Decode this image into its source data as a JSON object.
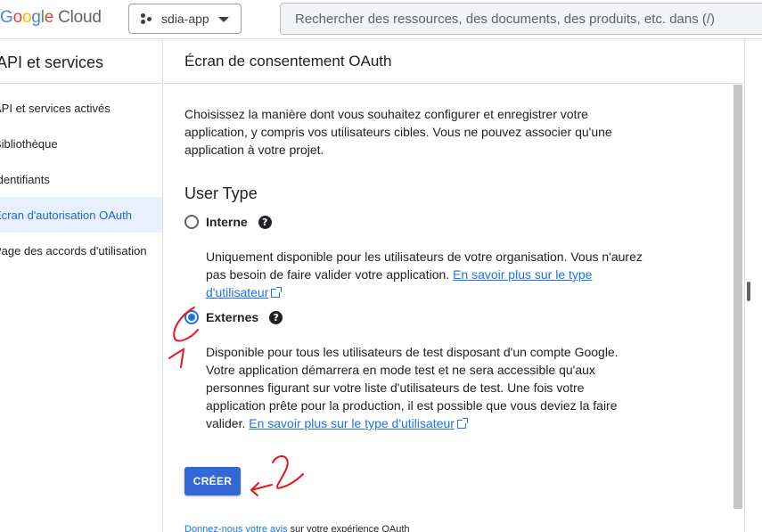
{
  "header": {
    "logo_google": "Google",
    "logo_cloud": "Cloud",
    "project": "sdia-app",
    "search_placeholder": "Rechercher des ressources, des documents, des produits, etc. dans (/)"
  },
  "sidebar": {
    "title": "API et services",
    "items": [
      {
        "label": "API et services activés"
      },
      {
        "label": "Bibliothèque"
      },
      {
        "label": "Identifiants"
      },
      {
        "label": "Écran d'autorisation OAuth",
        "active": true
      },
      {
        "label": "Page des accords d'utilisation"
      }
    ]
  },
  "main": {
    "title": "Écran de consentement OAuth",
    "intro": "Choisissez la manière dont vous souhaitez configurer et enregistrer votre application, y compris vos utilisateurs cibles. Vous ne pouvez associer qu'une application à votre projet.",
    "user_type_title": "User Type",
    "internal": {
      "label": "Interne",
      "selected": false,
      "description": "Uniquement disponible pour les utilisateurs de votre organisation. Vous n'aurez pas besoin de faire valider votre application. ",
      "link": "En savoir plus sur le type d'utilisateur"
    },
    "external": {
      "label": "Externes",
      "selected": true,
      "description": "Disponible pour tous les utilisateurs de test disposant d'un compte Google. Votre application démarrera en mode test et ne sera accessible qu'aux personnes figurant sur votre liste d'utilisateurs de test. Une fois votre application prête pour la production, il est possible que vous deviez la faire valider. ",
      "link": "En savoir plus sur le type d'utilisateur"
    },
    "create_label": "CRÉER",
    "feedback_link": "Donnez-nous votre avis",
    "feedback_text": " sur votre expérience OAuth"
  },
  "annotations": {
    "mark_1": "1",
    "mark_2": "2",
    "color": "#e8141b"
  }
}
